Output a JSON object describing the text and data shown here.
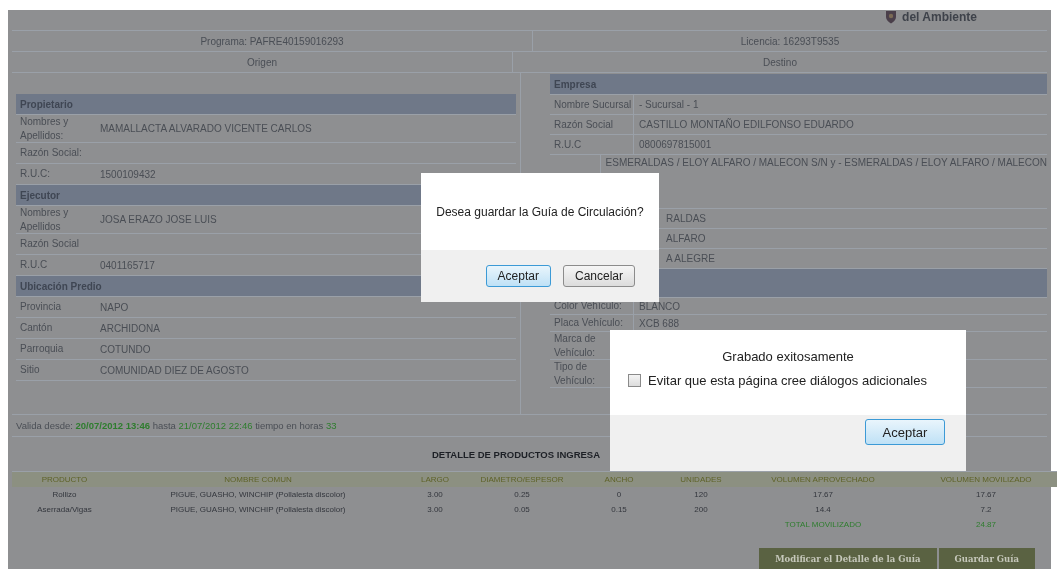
{
  "header": {
    "logo_text": "del Ambiente"
  },
  "program": "Programa: PAFRE40159016293",
  "license": "Licencia: 16293T9535",
  "origin": {
    "title": "Origen",
    "sections": [
      {
        "title": "Propietario",
        "rows": [
          {
            "label": "Nombres y Apellidos:",
            "value": "MAMALLACTA ALVARADO VICENTE CARLOS"
          },
          {
            "label": "Razón Social:"
          },
          {
            "label": "R.U.C:",
            "value": "1500109432"
          }
        ]
      },
      {
        "title": "Ejecutor",
        "rows": [
          {
            "label": "Nombres y Apellidos",
            "value": "JOSA ERAZO JOSE LUIS"
          },
          {
            "label": "Razón Social"
          },
          {
            "label": "R.U.C",
            "value": "0401165717"
          }
        ]
      },
      {
        "title": "Ubicación Predio",
        "rows": [
          {
            "label": "Provincia",
            "value": "NAPO"
          },
          {
            "label": "Cantón",
            "value": "ARCHIDONA"
          },
          {
            "label": "Parroquia",
            "value": "COTUNDO"
          },
          {
            "label": "Sitio",
            "value": "COMUNIDAD DIEZ DE AGOSTO"
          }
        ]
      }
    ]
  },
  "destination": {
    "title": "Destino",
    "sections": [
      {
        "title": "Empresa",
        "rows": [
          {
            "label": "Nombre Sucursal",
            "value": "- Sucursal - 1"
          },
          {
            "label": "Razón Social",
            "value": "CASTILLO MONTAÑO EDILFONSO EDUARDO"
          },
          {
            "label": "R.U.C",
            "value": "0800697815001"
          },
          {
            "value": "ESMERALDAS / ELOY ALFARO / MALECON S/N y - ESMERALDAS / ELOY ALFARO / MALECON",
            "kind": "tall"
          },
          {
            "value": "RALDAS",
            "kind": "cut"
          },
          {
            "value": "ALFARO",
            "kind": "cut"
          },
          {
            "value": "A ALEGRE",
            "kind": "cut"
          }
        ]
      },
      {
        "rows": [
          {
            "label": "Color Vehículo:",
            "value": "BLANCO"
          },
          {
            "label": "Placa Vehículo:",
            "value": "XCB 688"
          },
          {
            "label": "Marca de Vehículo:",
            "kind": "two_line"
          },
          {
            "label": "Tipo de Vehículo:",
            "kind": "two_line"
          }
        ]
      }
    ]
  },
  "validity": {
    "label": "Valida desde:",
    "from": "20/07/2012 13:46",
    "until_label": "hasta",
    "until": "21/07/2012 22:46",
    "hours_label": "tiempo en horas",
    "hours": "33"
  },
  "products": {
    "title": "DETALLE DE PRODUCTOS INGRESA",
    "columns": [
      "PRODUCTO",
      "NOMBRE COMUN",
      "LARGO",
      "DIAMETRO/ESPESOR",
      "ANCHO",
      "UNIDADES",
      "VOLUMEN APROVECHADO",
      "VOLUMEN MOVILIZADO"
    ],
    "rows": [
      [
        "Rollizo",
        "PIGUE, GUASHO, WINCHIP (Pollalesta discolor)",
        "3.00",
        "0.25",
        "0",
        "120",
        "17.67",
        "17.67"
      ],
      [
        "Aserrada/Vigas",
        "PIGUE, GUASHO, WINCHIP (Pollalesta discolor)",
        "3.00",
        "0.05",
        "0.15",
        "200",
        "14.4",
        "7.2"
      ]
    ],
    "total": {
      "label": "TOTAL MOVILIZADO",
      "value": "24.87"
    }
  },
  "actions": [
    "Modificar el Detalle de la Guía",
    "Guardar Guía"
  ],
  "confirm_dialog": {
    "message": "Desea guardar la Guía de Circulación?",
    "buttons": [
      {
        "label": "Aceptar",
        "selected": true
      },
      {
        "label": "Cancelar",
        "selected": false
      }
    ]
  },
  "alert_dialog": {
    "message": "Grabado exitosamente",
    "checkbox": {
      "label": "Evitar que esta página cree diálogos adicionales",
      "checked": false
    },
    "buttons": [
      {
        "label": "Aceptar",
        "selected": true
      }
    ]
  }
}
